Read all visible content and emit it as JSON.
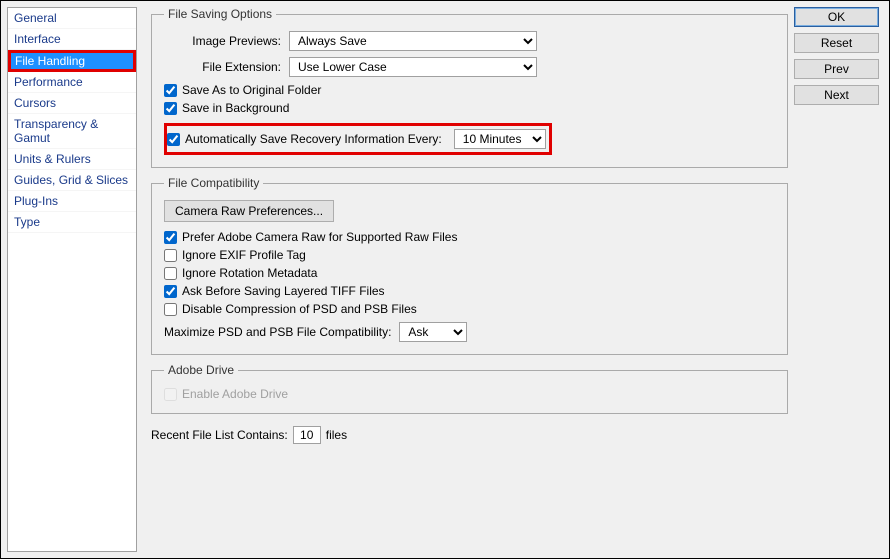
{
  "buttons": {
    "ok": "OK",
    "reset": "Reset",
    "prev": "Prev",
    "next": "Next"
  },
  "sidebar": {
    "items": [
      "General",
      "Interface",
      "File Handling",
      "Performance",
      "Cursors",
      "Transparency & Gamut",
      "Units & Rulers",
      "Guides, Grid & Slices",
      "Plug-Ins",
      "Type"
    ],
    "selected_index": 2
  },
  "fileSaving": {
    "legend": "File Saving Options",
    "imagePreviews": {
      "label": "Image Previews:",
      "value": "Always Save"
    },
    "fileExtension": {
      "label": "File Extension:",
      "value": "Use Lower Case"
    },
    "saveAsOriginal": {
      "label": "Save As to Original Folder",
      "checked": true
    },
    "saveInBackground": {
      "label": "Save in Background",
      "checked": true
    },
    "autoSaveRecovery": {
      "label": "Automatically Save Recovery Information Every:",
      "checked": true,
      "interval": "10 Minutes"
    }
  },
  "fileCompat": {
    "legend": "File Compatibility",
    "cameraRawBtn": "Camera Raw Preferences...",
    "preferRaw": {
      "label": "Prefer Adobe Camera Raw for Supported Raw Files",
      "checked": true
    },
    "ignoreExif": {
      "label": "Ignore EXIF Profile Tag",
      "checked": false
    },
    "ignoreRotation": {
      "label": "Ignore Rotation Metadata",
      "checked": false
    },
    "askTiff": {
      "label": "Ask Before Saving Layered TIFF Files",
      "checked": true
    },
    "disableCompression": {
      "label": "Disable Compression of PSD and PSB Files",
      "checked": false
    },
    "maxCompat": {
      "label": "Maximize PSD and PSB File Compatibility:",
      "value": "Ask"
    }
  },
  "adobeDrive": {
    "legend": "Adobe Drive",
    "enable": {
      "label": "Enable Adobe Drive",
      "checked": false,
      "disabled": true
    }
  },
  "recent": {
    "label": "Recent File List Contains:",
    "value": "10",
    "suffix": "files"
  }
}
